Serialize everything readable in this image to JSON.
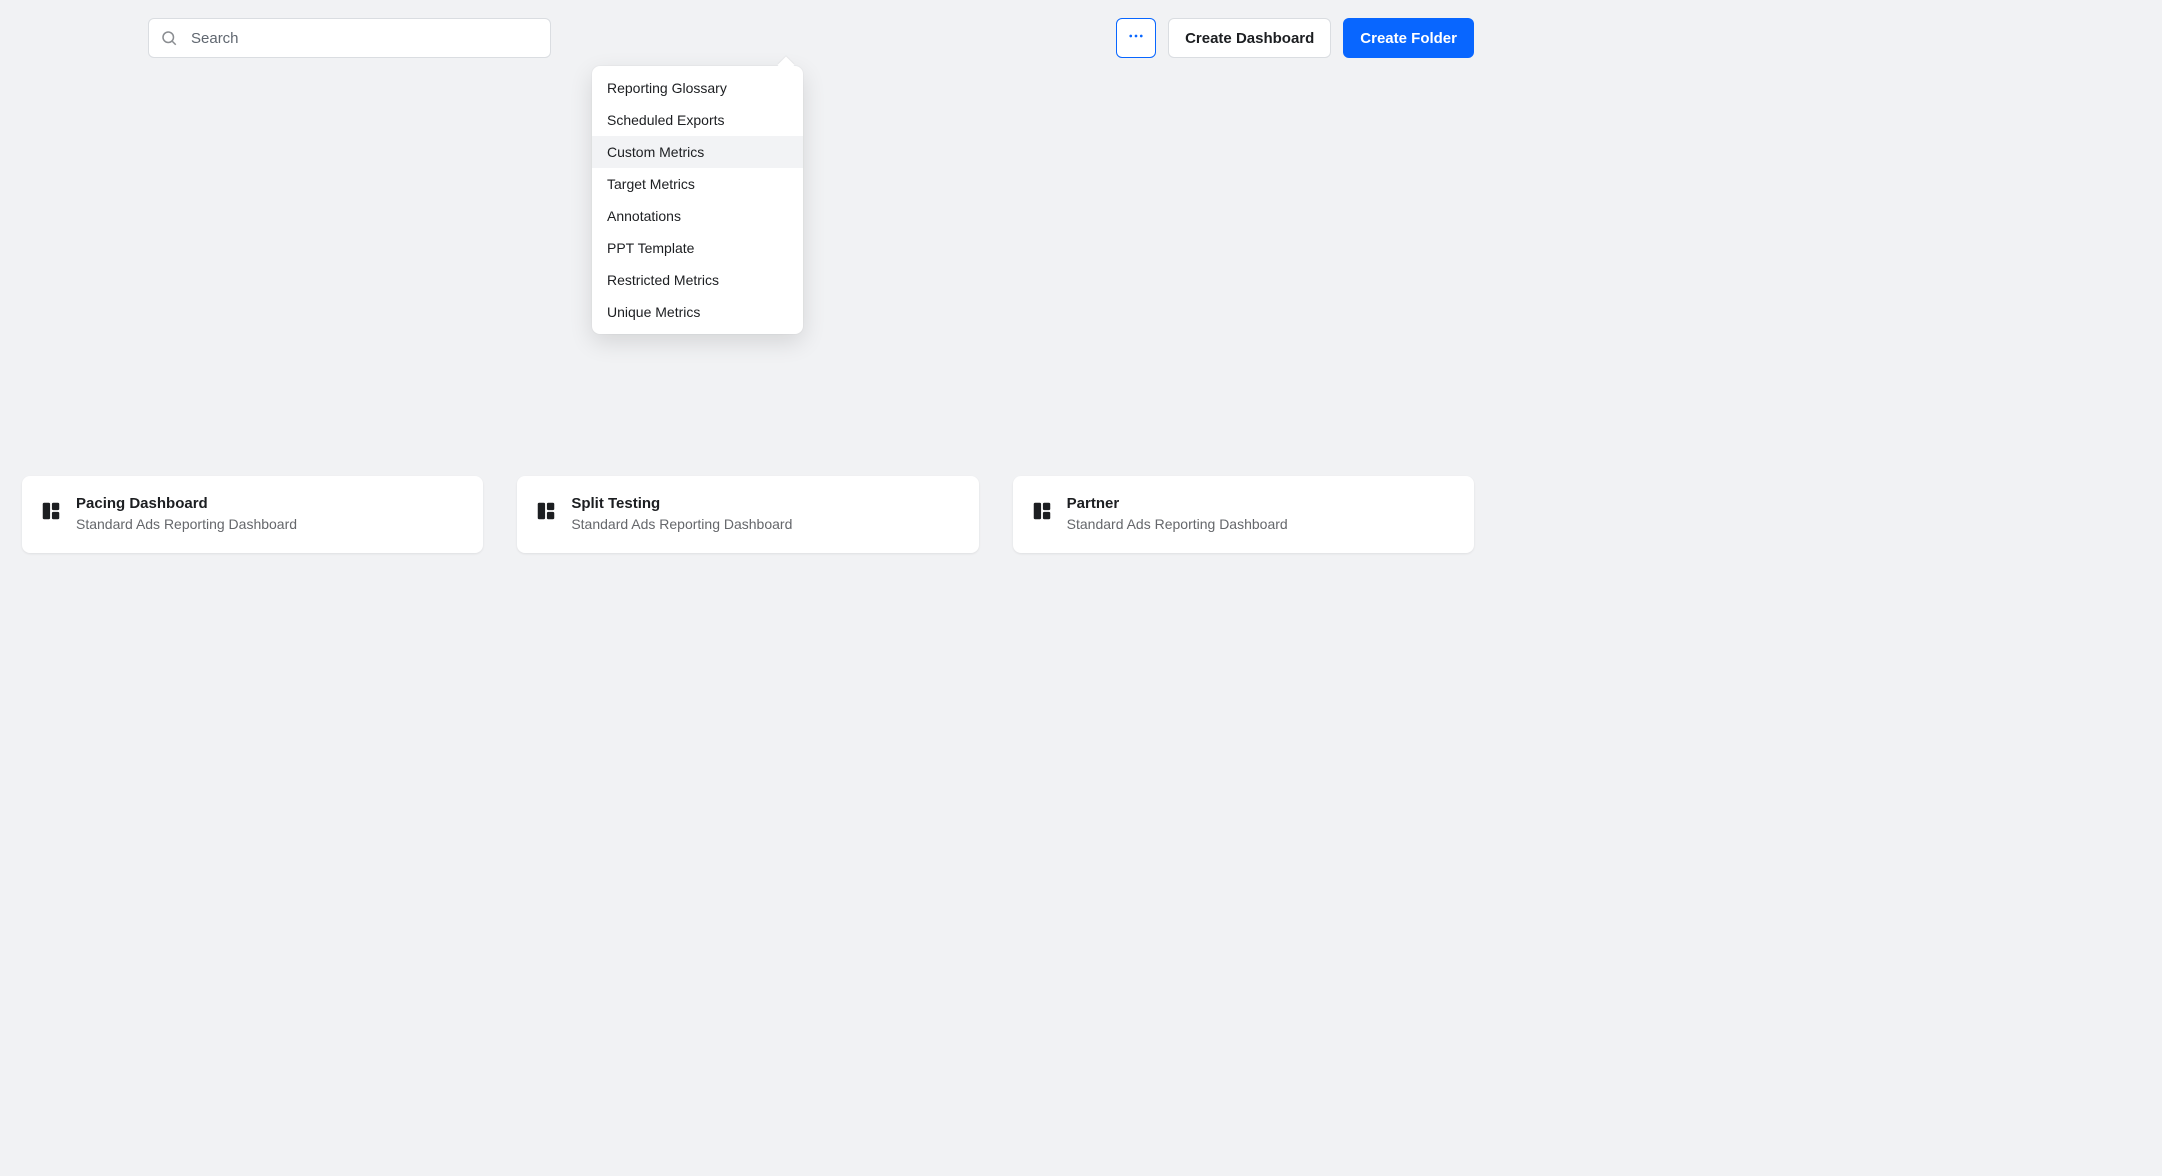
{
  "search": {
    "placeholder": "Search"
  },
  "toolbar": {
    "create_dashboard": "Create Dashboard",
    "create_folder": "Create Folder"
  },
  "menu": {
    "items": [
      {
        "label": "Reporting Glossary",
        "hover": false
      },
      {
        "label": "Scheduled Exports",
        "hover": false
      },
      {
        "label": "Custom Metrics",
        "hover": true
      },
      {
        "label": "Target Metrics",
        "hover": false
      },
      {
        "label": "Annotations",
        "hover": false
      },
      {
        "label": "PPT Template",
        "hover": false
      },
      {
        "label": "Restricted Metrics",
        "hover": false
      },
      {
        "label": "Unique Metrics",
        "hover": false
      }
    ]
  },
  "cards": [
    {
      "title": "Pacing Dashboard",
      "subtitle": "Standard Ads Reporting Dashboard"
    },
    {
      "title": "Split Testing",
      "subtitle": "Standard Ads Reporting Dashboard"
    },
    {
      "title": "Partner",
      "subtitle": "Standard Ads Reporting Dashboard"
    }
  ],
  "colors": {
    "accent": "#0866ff"
  }
}
